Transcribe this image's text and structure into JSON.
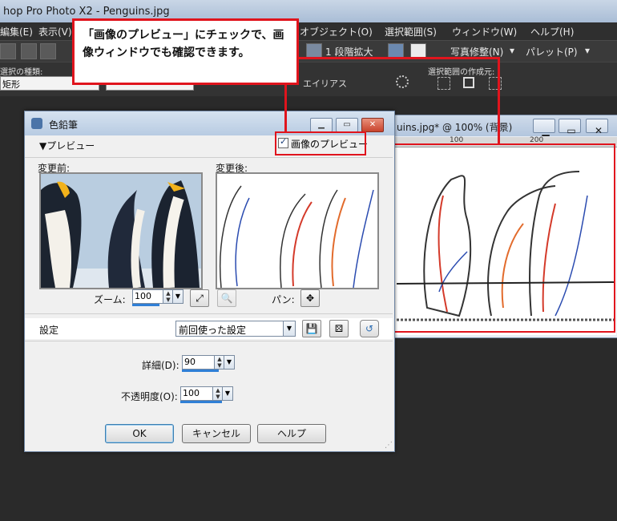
{
  "app": {
    "title": "hop Pro Photo X2 - Penguins.jpg",
    "menus": [
      "編集(E)",
      "表示(V)",
      "オブジェクト(O)",
      "選択範囲(S)",
      "ウィンドウ(W)",
      "ヘルプ(H)"
    ],
    "toolbar_zoom": "1 段階拡大",
    "toolbar_photo_fix": "写真修整(N)",
    "toolbar_palette": "パレット(P)"
  },
  "options_bar": {
    "select_type_label": "選択の種類:",
    "select_type_value": "矩形",
    "antialias_label": "エイリアス",
    "create_from_label": "選択範囲の作成元:"
  },
  "callout": {
    "text": "「画像のプレビュー」にチェックで、画像ウィンドウでも確認できます。"
  },
  "image_window": {
    "title": "uins.jpg* @ 100% (背景)",
    "ruler_marks": [
      "100",
      "200"
    ]
  },
  "dialog": {
    "title": "色鉛筆",
    "preview_toggle": "▼プレビュー",
    "image_preview_checkbox": "画像のプレビュー",
    "image_preview_checked": true,
    "before_label": "変更前:",
    "after_label": "変更後:",
    "zoom_label": "ズーム:",
    "zoom_value": "100",
    "pan_label": "パン:",
    "settings_label": "設定",
    "settings_value": "前回使った設定",
    "detail_label": "詳細(D):",
    "detail_value": "90",
    "opacity_label": "不透明度(O):",
    "opacity_value": "100",
    "ok_button": "OK",
    "cancel_button": "キャンセル",
    "help_button": "ヘルプ"
  },
  "colors": {
    "highlight": "#e0141d",
    "workspace": "#2a2a2a",
    "dialog_bg": "#f0f0f0"
  }
}
